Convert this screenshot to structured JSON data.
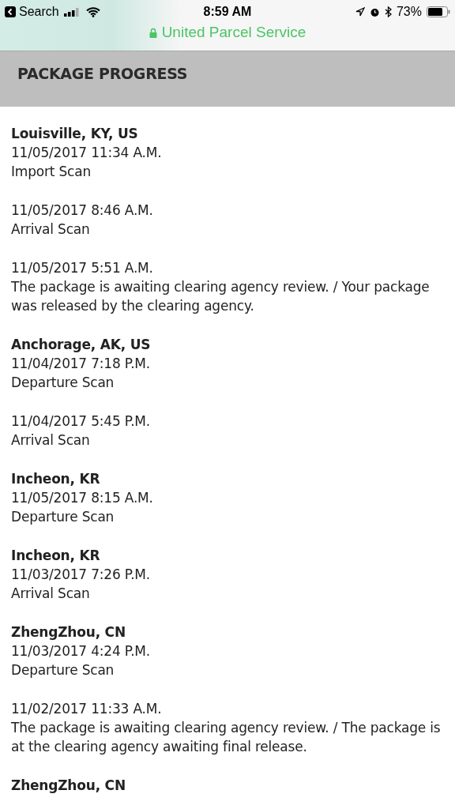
{
  "status_bar": {
    "back_label": "Search",
    "time": "8:59 AM",
    "battery": "73%"
  },
  "site_title": "United Parcel Service",
  "header": {
    "title": "PACKAGE PROGRESS"
  },
  "events": [
    {
      "location": "Louisville, KY, US",
      "datetime": "11/05/2017 11:34 A.M.",
      "activity": "Import Scan"
    },
    {
      "datetime": "11/05/2017 8:46 A.M.",
      "activity": "Arrival Scan"
    },
    {
      "datetime": "11/05/2017 5:51 A.M.",
      "activity": "The package is awaiting clearing agency review. / Your package was released by the clearing agency."
    },
    {
      "location": "Anchorage, AK, US",
      "datetime": "11/04/2017 7:18 P.M.",
      "activity": "Departure Scan"
    },
    {
      "datetime": "11/04/2017 5:45 P.M.",
      "activity": "Arrival Scan"
    },
    {
      "location": "Incheon, KR",
      "datetime": "11/05/2017 8:15 A.M.",
      "activity": "Departure Scan"
    },
    {
      "location": "Incheon, KR",
      "datetime": "11/03/2017 7:26 P.M.",
      "activity": "Arrival Scan"
    },
    {
      "location": "ZhengZhou, CN",
      "datetime": "11/03/2017 4:24 P.M.",
      "activity": "Departure Scan"
    },
    {
      "datetime": "11/02/2017 11:33 A.M.",
      "activity": "The package is awaiting clearing agency review. / The package is at the clearing agency awaiting final release."
    },
    {
      "location": "ZhengZhou, CN"
    }
  ]
}
